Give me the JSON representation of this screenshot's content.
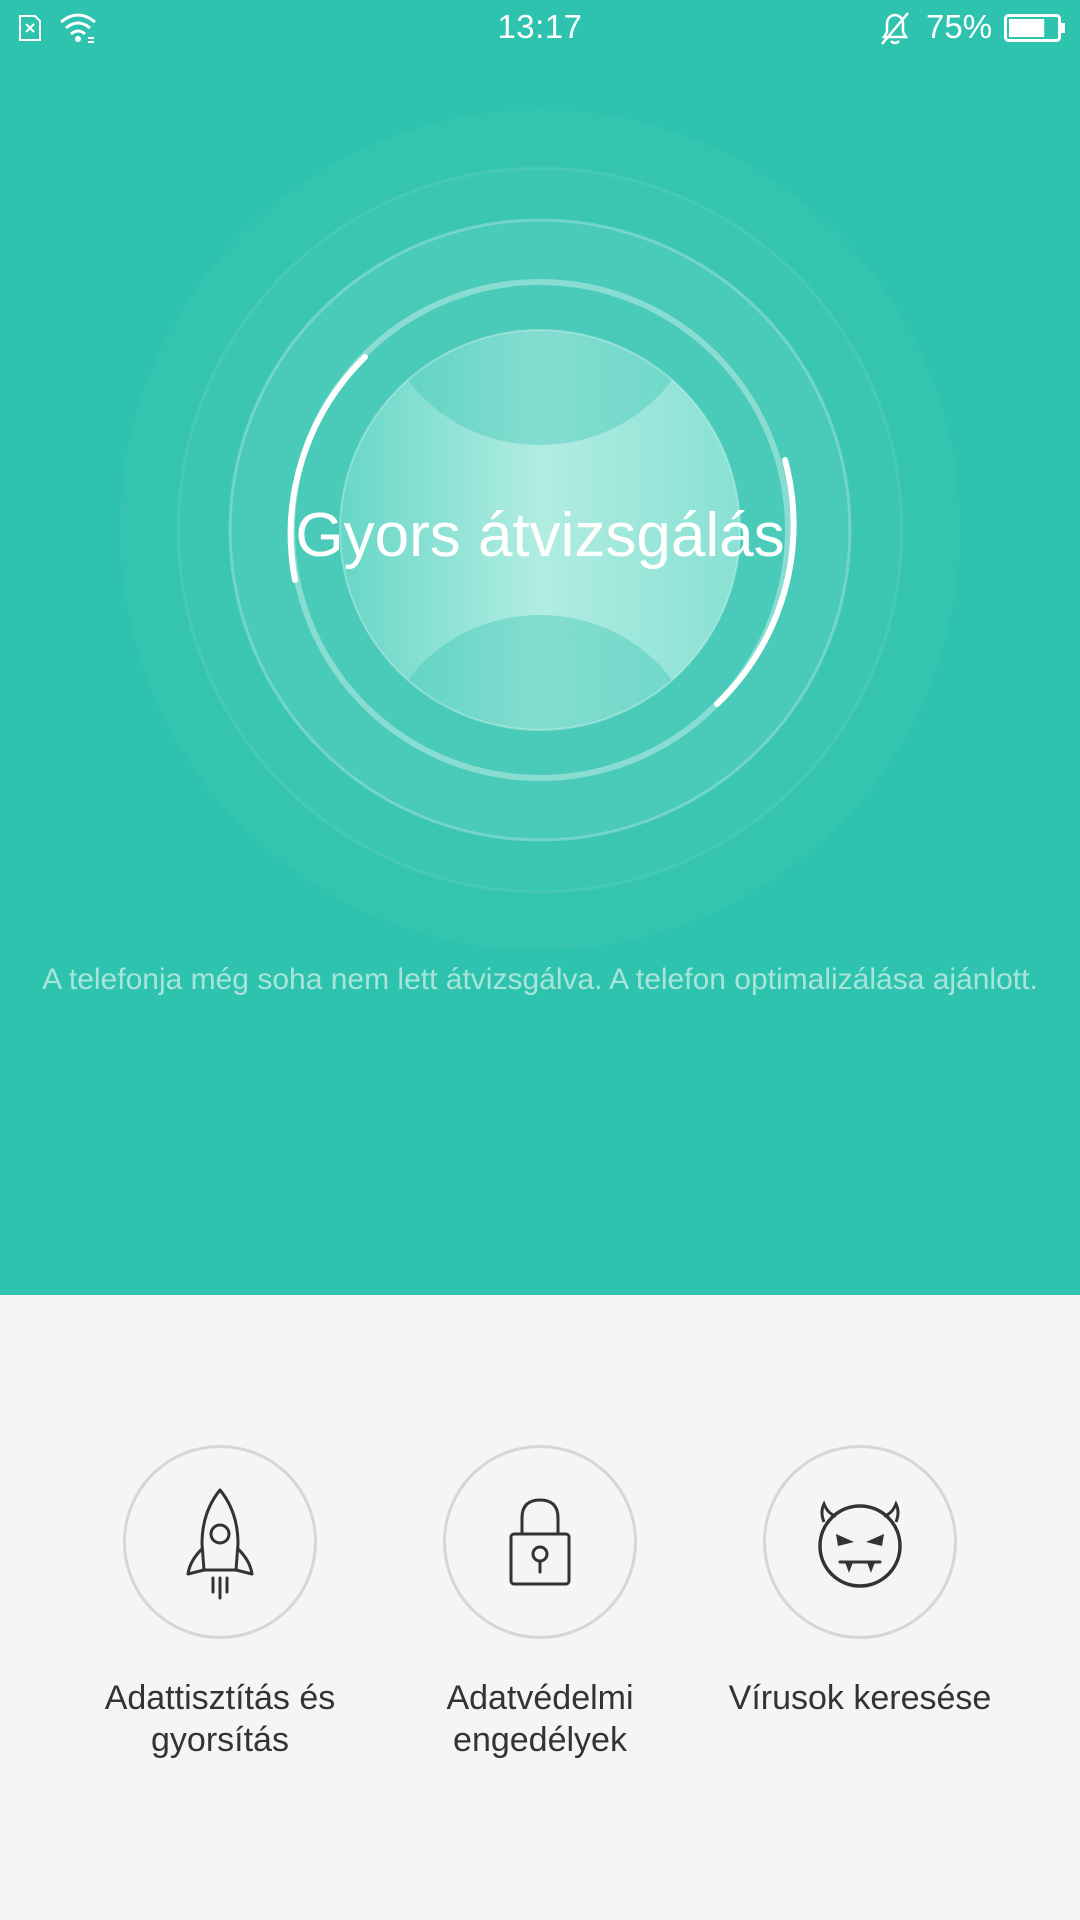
{
  "status_bar": {
    "time": "13:17",
    "battery_percent": "75%",
    "battery_level": 0.75,
    "icons": [
      "sim-none-icon",
      "wifi-icon",
      "bell-muted-icon",
      "battery-icon"
    ]
  },
  "scan": {
    "title": "Gyors átvizsgálás",
    "hint": "A telefonja még soha nem lett átvizsgálva. A telefon optimalizálása ajánlott."
  },
  "features": [
    {
      "icon": "rocket-icon",
      "label_line1": "Adattisztítás és",
      "label_line2": "gyorsítás"
    },
    {
      "icon": "padlock-icon",
      "label_line1": "Adatvédelmi",
      "label_line2": "engedélyek"
    },
    {
      "icon": "devil-face-icon",
      "label_line1": "Vírusok keresése",
      "label_line2": ""
    }
  ],
  "colors": {
    "accent": "#2ec3ae",
    "background": "#f5f5f5",
    "text": "#333333",
    "hint_text": "#a8e4d9"
  }
}
